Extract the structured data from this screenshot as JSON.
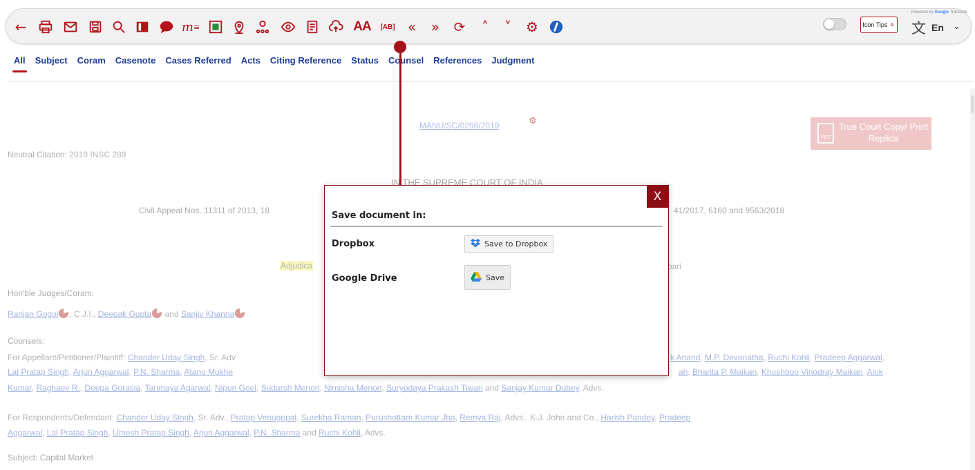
{
  "toolbar": {
    "icons": [
      "back-arrow-icon",
      "print-icon",
      "mail-icon",
      "save-icon",
      "search-icon",
      "book-icon",
      "comment-icon",
      "mindmap-icon",
      "highlight-icon",
      "location-icon",
      "network-icon",
      "view-icon",
      "notes-icon",
      "cloud-upload-icon",
      "font-size-icon",
      "abbreviation-icon",
      "previous-icon",
      "next-icon",
      "refresh-icon",
      "collapse-icon",
      "expand-icon",
      "settings-icon",
      "info-icon"
    ],
    "font_size_label": "AA",
    "abbreviation_label": "[AB]",
    "mindmap_label": "m",
    "icon_tips_label": "Icon Tips",
    "powered_by": "Powered by",
    "google_label": "Google",
    "translate_suffix": "Translate",
    "language": "En",
    "accent_color": "#b5121b"
  },
  "tabs": [
    "All",
    "Subject",
    "Coram",
    "Casenote",
    "Cases Referred",
    "Acts",
    "Citing Reference",
    "Status",
    "Counsel",
    "References",
    "Judgment"
  ],
  "active_tab": "All",
  "document": {
    "manu_citation": "MANU/SC/0296/2019",
    "true_copy": "True Court Copy/ Print Replica",
    "pdf_label": "PDF",
    "neutral_label": "Neutral Citation:",
    "neutral_value": "2019 INSC 289",
    "court": "IN THE SUPREME COURT OF INDIA",
    "appeal_start": "Civil Appeal Nos. 11311 of 2013, 18",
    "appeal_end": "41/2017, 6160 and 9563/2018",
    "adjudicated": "Adjudica",
    "adjudicated_end": "bari",
    "judges_heading": "Hon'ble Judges/Coram:",
    "judge_1": "Ranjan Gogoi",
    "judge_1_suffix": ", C.J.I.,",
    "judge_2": "Deepak Gupta",
    "judge_and": "and",
    "judge_3": "Sanjiv Khanna",
    "counsels_heading": "Counsels:",
    "appellant_label": "For Appellant/Petitioner/Plaintiff:",
    "appellant_1": "Chander Uday Singh",
    "appellant_1_suffix": ", Sr. Adv",
    "appellant_2": "k Anand",
    "appellant_3": "M.P. Devanatha",
    "appellant_4": "Ruchi Kohli",
    "appellant_5": "Pradeep Aggarwal",
    "line2_1": "Lal Pratap Singh",
    "line2_2": "Arjun Aggarwal",
    "line2_3": "P.N. Sharma",
    "line2_4": "Atanu Mukhe",
    "line2_5": "ah",
    "line2_6": "Bharita P. Maikan",
    "line2_7": "Khushboo Vinodray Maikan",
    "line2_8": "Alok",
    "line3_1": "Kumar",
    "line3_2": "Raghaev R.",
    "line3_3": "Deepa Gorasia",
    "line3_4": "Tanmaya Agarwal",
    "line3_5": "Nipun Goel",
    "line3_6": "Sudarsh Menon",
    "line3_7": "Nimisha Menon",
    "line3_8": "Suryodaya Prakash Tiwari",
    "line3_and": "and",
    "line3_9": "Sanjay Kumar Dubey",
    "line3_end": ", Advs.",
    "resp_label": "For Respondents/Defendant:",
    "resp_1": "Chander Uday Singh",
    "resp_1_suffix": ", Sr. Adv.,",
    "resp_2": "Pratap Venugopal",
    "resp_3": "Surekha Raman",
    "resp_4": "Purushottam Kumar Jha",
    "resp_5": "Remya Raj",
    "resp_5_suffix": ", Advs., K.J. John and Co.,",
    "resp_6": "Harish Pandey",
    "resp_7": "Pradeep",
    "resp2_1": "Aggarwal",
    "resp2_2": "Lal Pratap Singh",
    "resp2_3": "Umesh Pratap Singh",
    "resp2_4": "Arjun Aggarwal",
    "resp2_5": "P.N. Sharma",
    "resp2_and": "and",
    "resp2_6": "Ruchi Kohli",
    "resp2_end": ", Advs.",
    "subject": "Subject: Capital Market",
    "sep": ", "
  },
  "modal": {
    "title": "Save document in:",
    "close": "X",
    "services": [
      {
        "name": "Dropbox",
        "button": "Save to Dropbox"
      },
      {
        "name": "Google Drive",
        "button": "Save"
      }
    ]
  }
}
